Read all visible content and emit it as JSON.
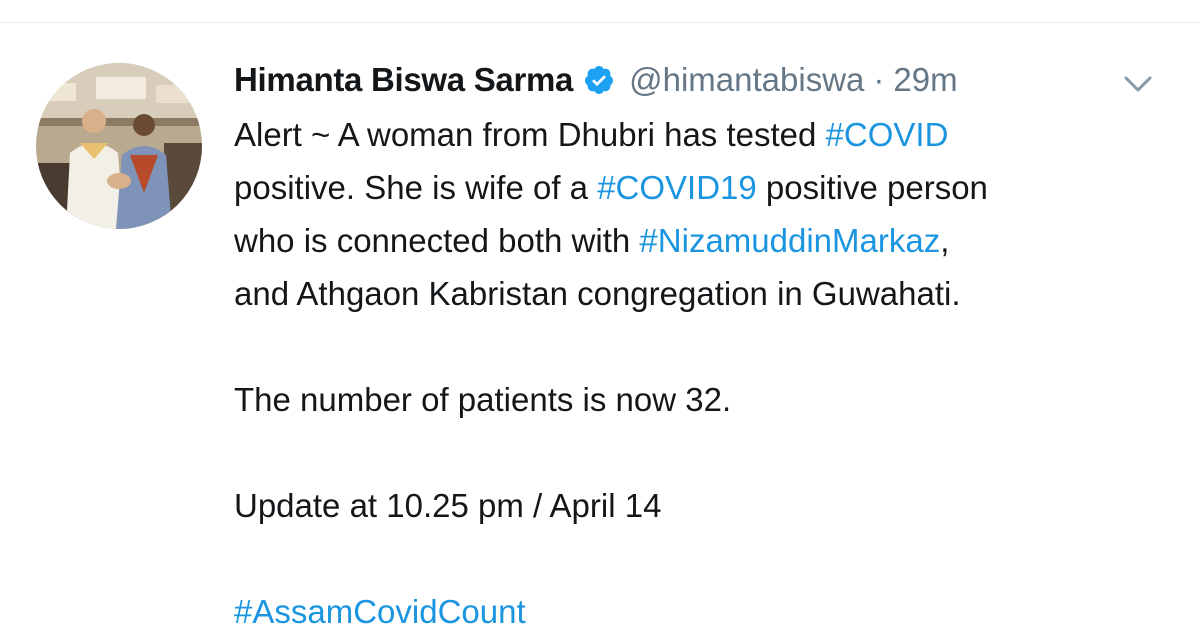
{
  "tweet": {
    "display_name": "Himanta Biswa Sarma",
    "handle": "@himantabiswa",
    "separator": "·",
    "time": "29m",
    "line1_text": "Alert ~ A woman from Dhubri has tested ",
    "line1_hashtag": "#COVID",
    "line2_text_a": "positive. She is wife of a ",
    "line2_hashtag": "#COVID19",
    "line2_text_b": " positive person",
    "line3_text": "who is connected both with ",
    "line3_hashtag": "#NizamuddinMarkaz",
    "line3_tail": ",",
    "line4_text": "and Athgaon Kabristan congregation in Guwahati.",
    "line5_text": "The number of patients is now 32.",
    "line6_text": "Update at 10.25 pm / April 14",
    "line7_hashtag": "#AssamCovidCount"
  },
  "icons": {
    "verified": "verified-badge-icon",
    "menu": "chevron-down-icon"
  },
  "colors": {
    "link": "#1b95e0",
    "muted": "#657786",
    "text": "#14171a",
    "verified": "#1da1f2"
  }
}
